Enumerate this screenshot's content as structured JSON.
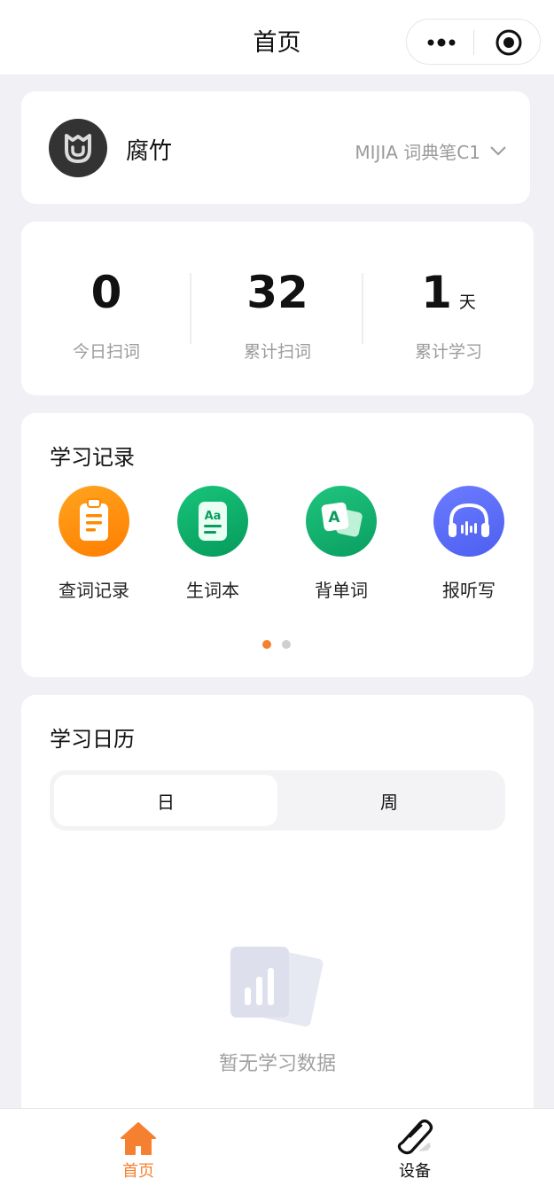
{
  "nav": {
    "title": "首页"
  },
  "profile": {
    "name": "腐竹",
    "device": "MIJIA 词典笔C1"
  },
  "stats": [
    {
      "value": "0",
      "unit": "",
      "label": "今日扫词"
    },
    {
      "value": "32",
      "unit": "",
      "label": "累计扫词"
    },
    {
      "value": "1",
      "unit": "天",
      "label": "累计学习"
    }
  ],
  "records": {
    "title": "学习记录",
    "items": [
      {
        "label": "查词记录",
        "icon": "clipboard-icon",
        "color": "#ff8a00"
      },
      {
        "label": "生词本",
        "icon": "vocab-book-icon",
        "color": "#0fae6a"
      },
      {
        "label": "背单词",
        "icon": "flashcard-icon",
        "color": "#12b26e"
      },
      {
        "label": "报听写",
        "icon": "headphones-icon",
        "color": "#5b6cf5"
      }
    ],
    "page_count": 2,
    "active_page": 1
  },
  "calendar": {
    "title": "学习日历",
    "tabs": [
      "日",
      "周"
    ],
    "selected_tab": "日",
    "empty_text": "暂无学习数据"
  },
  "tabbar": [
    {
      "label": "首页",
      "icon": "home-icon",
      "active": true
    },
    {
      "label": "设备",
      "icon": "pen-icon",
      "active": false
    }
  ],
  "colors": {
    "accent": "#f5802f",
    "background": "#f0f0f5"
  }
}
